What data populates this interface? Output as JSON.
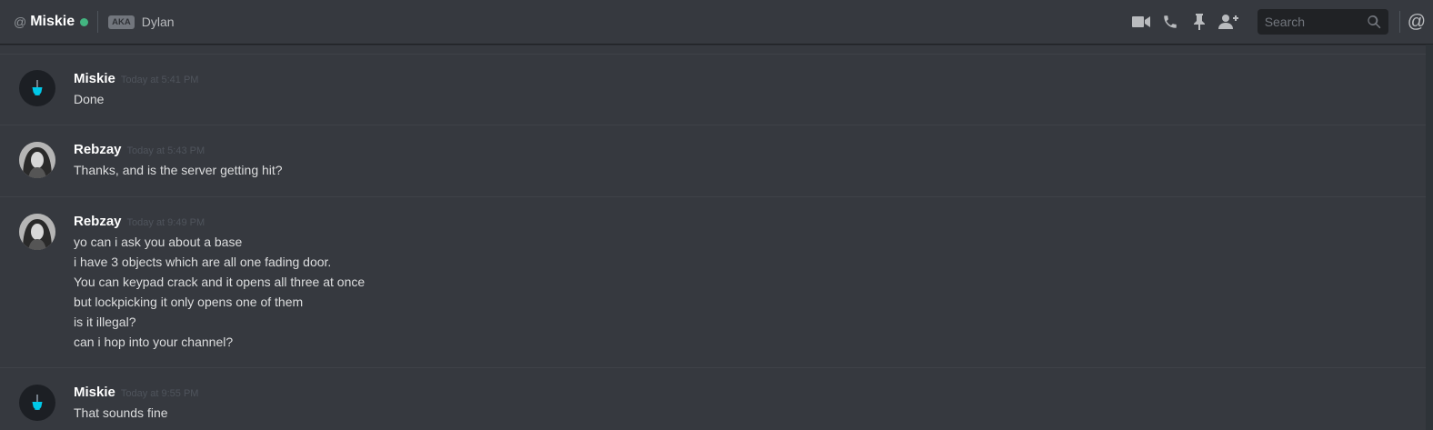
{
  "header": {
    "at_symbol": "@",
    "name": "Miskie",
    "status_color": "#43b581",
    "aka_badge": "AKA",
    "aka_name": "Dylan"
  },
  "toolbar": {
    "icons": [
      "video-camera-icon",
      "phone-icon",
      "pin-icon",
      "add-friend-icon"
    ],
    "search_placeholder": "Search",
    "mention_symbol": "@"
  },
  "messages": [
    {
      "author": "Miskie",
      "timestamp": "Today at 5:41 PM",
      "lines": [
        "Done"
      ]
    },
    {
      "author": "Rebzay",
      "timestamp": "Today at 5:43 PM",
      "lines": [
        "Thanks, and is the server getting hit?"
      ]
    },
    {
      "author": "Rebzay",
      "timestamp": "Today at 9:49 PM",
      "lines": [
        "yo can i ask you about a base",
        "i have 3 objects which are all one fading door.",
        "You can keypad crack and it opens all three at once",
        "but lockpicking it only opens one of them",
        "is it illegal?",
        "can i hop into your channel?"
      ]
    },
    {
      "author": "Miskie",
      "timestamp": "Today at 9:55 PM",
      "lines": [
        "That sounds fine"
      ]
    }
  ],
  "colors": {
    "background": "#36393f",
    "accent_cyan": "#00c8e8"
  }
}
